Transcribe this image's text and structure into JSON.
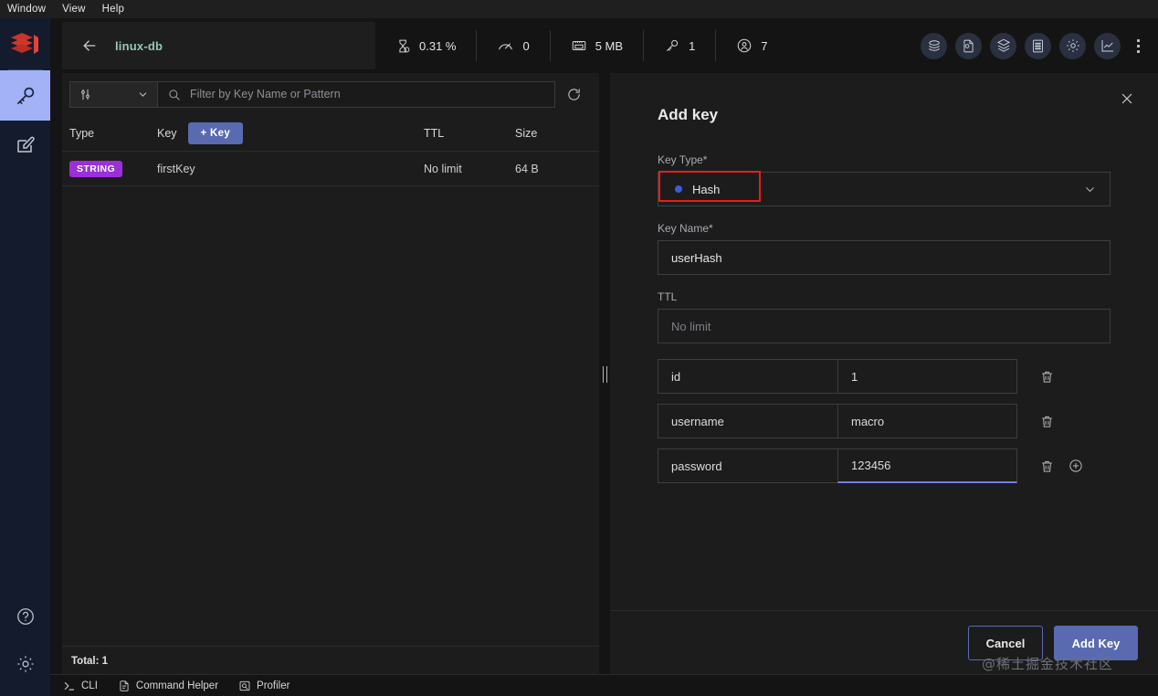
{
  "menubar": {
    "items": [
      {
        "label": "Window"
      },
      {
        "label": "View"
      },
      {
        "label": "Help"
      }
    ]
  },
  "rail": {
    "logo": "redis-logo",
    "items": [
      {
        "name": "browser",
        "icon": "key-icon",
        "active": true
      },
      {
        "name": "workbench",
        "icon": "edit-square-icon",
        "active": false
      }
    ],
    "bottom": [
      {
        "name": "help",
        "icon": "question-circle-icon"
      },
      {
        "name": "settings",
        "icon": "gear-icon"
      }
    ]
  },
  "topbar": {
    "back_icon": "arrow-left-icon",
    "db_name": "linux-db",
    "metrics": [
      {
        "icon": "cpu-icon",
        "value": "0.31 %"
      },
      {
        "icon": "speedometer-icon",
        "value": "0"
      },
      {
        "icon": "memory-icon",
        "value": "5 MB"
      },
      {
        "icon": "key-icon",
        "value": "1"
      },
      {
        "icon": "user-icon",
        "value": "7"
      }
    ],
    "tools": [
      {
        "name": "cluster-icon"
      },
      {
        "name": "slowlog-icon"
      },
      {
        "name": "layers-icon"
      },
      {
        "name": "memory-analysis-icon"
      },
      {
        "name": "settings-icon"
      },
      {
        "name": "analytics-icon"
      }
    ],
    "overflow_icon": "more-vertical-icon"
  },
  "keys": {
    "filter": {
      "select_icon": "sliders-icon",
      "chevron": "chevron-down-icon",
      "search_icon": "search-icon",
      "placeholder": "Filter by Key Name or Pattern",
      "value": "",
      "refresh_icon": "refresh-icon"
    },
    "columns": [
      "Type",
      "Key",
      "TTL",
      "Size"
    ],
    "add_key_label": "+ Key",
    "rows": [
      {
        "type": "STRING",
        "key": "firstKey",
        "ttl": "No limit",
        "size": "64 B"
      }
    ],
    "total": "Total: 1"
  },
  "panel": {
    "title": "Add key",
    "close_icon": "close-icon",
    "key_type": {
      "label": "Key Type*",
      "value": "Hash",
      "dot_color": "#3b5bdb",
      "chevron": "chevron-down-icon"
    },
    "key_name": {
      "label": "Key Name*",
      "value": "userHash"
    },
    "ttl": {
      "label": "TTL",
      "value": "",
      "placeholder": "No limit"
    },
    "pairs": [
      {
        "field": "id",
        "value": "1",
        "delete_icon": "trash-icon"
      },
      {
        "field": "username",
        "value": "macro",
        "delete_icon": "trash-icon"
      },
      {
        "field": "password",
        "value": "123456",
        "delete_icon": "trash-icon",
        "add_icon": "plus-circle-icon",
        "focused": true
      }
    ],
    "cancel_label": "Cancel",
    "submit_label": "Add Key"
  },
  "bottombar": {
    "items": [
      {
        "icon": "terminal-icon",
        "label": "CLI"
      },
      {
        "icon": "document-icon",
        "label": "Command Helper"
      },
      {
        "icon": "profiler-icon",
        "label": "Profiler"
      }
    ]
  },
  "watermark": {
    "text": "@稀土掘金技术社区"
  },
  "colors": {
    "accent": "#5a6ab1",
    "badge_string": "#9b30d9",
    "annotation": "#e02020",
    "db_name": "#96c7bd",
    "rail_active": "#a3b2f7"
  }
}
